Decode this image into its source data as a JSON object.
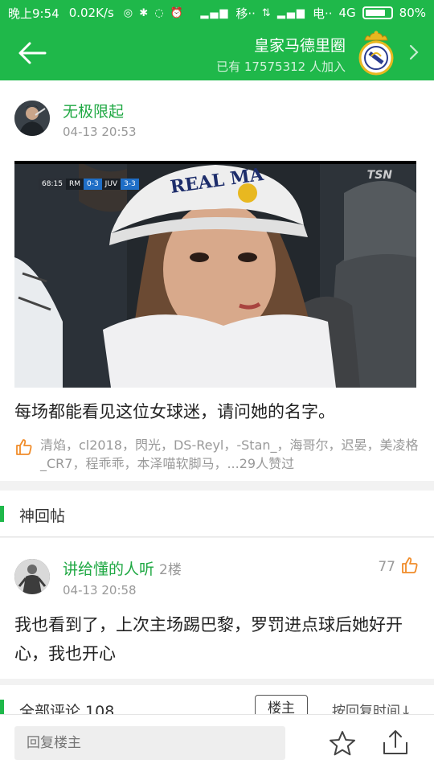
{
  "status_bar": {
    "time": "晚上9:54",
    "speed": "0.02K/s",
    "carrier1": "移··",
    "carrier2": "电··",
    "network": "4G",
    "battery": "80%",
    "battery_level": 0.8
  },
  "app_bar": {
    "back_icon": "arrow-left-icon",
    "circle_name": "皇家马德里圈",
    "member_text": "已有 17575312 人加入",
    "crest_icon": "real-madrid-crest-icon",
    "forward_icon": "chevron-right-icon"
  },
  "post": {
    "author": "无极限起",
    "time": "04-13 20:53",
    "scoreboard": {
      "clock": "68:15",
      "home": "RM",
      "score": "0-3",
      "away": "JUV",
      "agg": "3-3"
    },
    "broadcaster": "TSN",
    "cap_text": "REAL MA",
    "text": "每场都能看见这位女球迷，请问她的名字。",
    "likes_text": "清焰，cl2018，閃光，DS-Reyl，-Stan_，海哥尔，迟晏，美凌格_CR7，程乖乖，本泽喵软脚马，...29人赞过"
  },
  "hot_section": {
    "title": "神回帖"
  },
  "hot_comment": {
    "author": "讲给懂的人听",
    "floor": "2楼",
    "time": "04-13 20:58",
    "likes": "77",
    "text": "我也看到了，上次主场踢巴黎，罗罚进点球后她好开心，我也开心"
  },
  "all_comments": {
    "title": "全部评论 108",
    "op_filter": "楼主",
    "sort": "按回复时间↓"
  },
  "bottom_bar": {
    "reply_placeholder": "回复楼主",
    "star_icon": "star-icon",
    "share_icon": "share-icon"
  },
  "colors": {
    "brand_green": "#1fb84a",
    "name_green": "#1fa843",
    "like_orange": "#f08c2a"
  }
}
